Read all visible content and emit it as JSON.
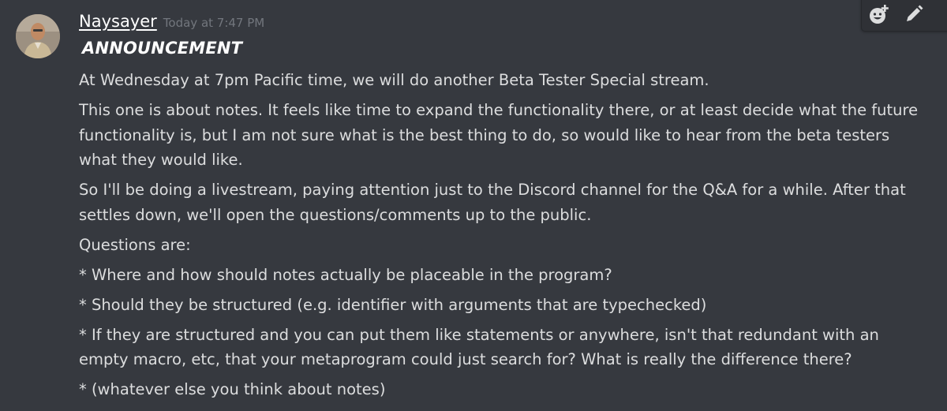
{
  "message": {
    "author": "Naysayer",
    "timestamp": "Today at 7:47 PM",
    "avatar_icon": "user-avatar-photo",
    "headline": "ANNOUNCEMENT",
    "paragraphs": [
      "At Wednesday at 7pm Pacific time, we will do another Beta Tester Special stream.",
      "This one is about notes. It feels like time to expand the functionality there, or at least decide what the future functionality is, but I am not sure what is the best thing to do, so would like to hear from the beta testers what they would like.",
      "So I'll be doing a livestream, paying attention just to the Discord channel for the Q&A for a while. After that settles down, we'll open the questions/comments up to the public.",
      "Questions are:",
      "* Where and how should notes actually be placeable in the program?",
      "* Should they be structured (e.g. identifier with arguments that are typechecked)",
      "* If they are structured and you can put them like statements or anywhere, isn't that redundant with an empty macro, etc, that your metaprogram could just search for? What is really the difference there?",
      "* (whatever else you think about notes)"
    ]
  },
  "toolbar": {
    "buttons": [
      "add-reaction-icon",
      "edit-pencil-icon"
    ]
  },
  "colors": {
    "background": "#36393f",
    "text": "#dcddde",
    "author": "#ffffff",
    "timestamp": "#72767d",
    "toolbar": "#2f3136"
  }
}
